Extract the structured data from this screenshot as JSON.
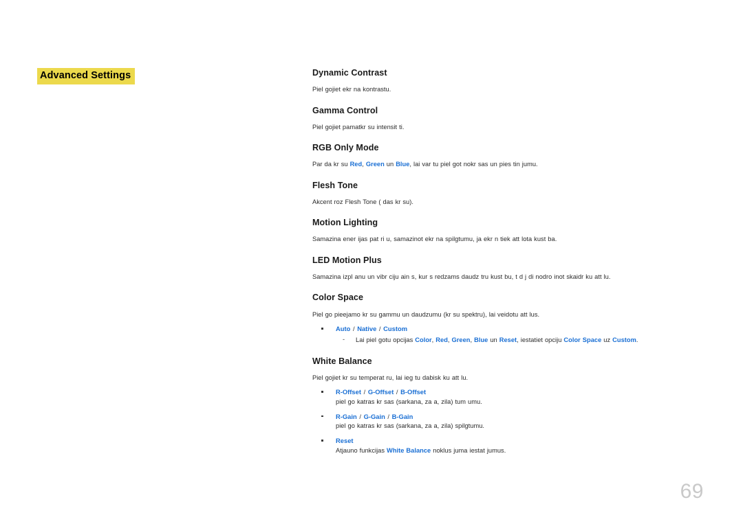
{
  "chapter": {
    "title": "Advanced Settings",
    "highlight_color": "#ecd94c"
  },
  "colors": {
    "accent_blue": "#1a6fd4",
    "heading": "#1a1a1a",
    "body": "#2b2b2b",
    "page_number": "#c9c9c9"
  },
  "settings": [
    {
      "heading": "Dynamic Contrast",
      "desc": "Piel gojiet ekr na kontrastu."
    },
    {
      "heading": "Gamma Control",
      "desc": "Piel gojiet pamatkr su intensit ti."
    },
    {
      "heading": "RGB Only Mode",
      "desc_parts": [
        {
          "t": "Par da kr su ",
          "style": "plain"
        },
        {
          "t": "Red",
          "style": "blue"
        },
        {
          "t": ", ",
          "style": "plain"
        },
        {
          "t": "Green",
          "style": "blue"
        },
        {
          "t": " un ",
          "style": "plain"
        },
        {
          "t": "Blue",
          "style": "blue"
        },
        {
          "t": ", lai var tu piel got nokr sas un pies tin jumu.",
          "style": "plain"
        }
      ]
    },
    {
      "heading": "Flesh Tone",
      "desc": "Akcent roz  Flesh Tone ( das kr su)."
    },
    {
      "heading": "Motion Lighting",
      "desc": "Samazina ener ijas pat ri u, samazinot ekr na spilgtumu, ja ekr n  tiek att lota kust ba."
    },
    {
      "heading": "LED Motion Plus",
      "desc": "Samazina izpl  anu un vibr ciju ain s, kur s redzams daudz  tru kust bu, t d j di nodro inot skaidr ku att lu."
    },
    {
      "heading": "Color Space",
      "desc": "Piel go pieejamo kr su gammu un daudzumu (kr su spektru), lai veidotu att lus.",
      "bullets": [
        {
          "title_parts": [
            {
              "t": "Auto",
              "style": "blue"
            },
            {
              "t": " / ",
              "style": "sep"
            },
            {
              "t": "Native",
              "style": "blue"
            },
            {
              "t": " / ",
              "style": "sep"
            },
            {
              "t": "Custom",
              "style": "blue"
            }
          ],
          "dashes": [
            {
              "parts": [
                {
                  "t": "Lai piel gotu opcijas ",
                  "style": "plain"
                },
                {
                  "t": "Color",
                  "style": "blue"
                },
                {
                  "t": ", ",
                  "style": "plain"
                },
                {
                  "t": "Red",
                  "style": "blue"
                },
                {
                  "t": ", ",
                  "style": "plain"
                },
                {
                  "t": "Green",
                  "style": "blue"
                },
                {
                  "t": ", ",
                  "style": "plain"
                },
                {
                  "t": "Blue",
                  "style": "blue"
                },
                {
                  "t": " un ",
                  "style": "plain"
                },
                {
                  "t": "Reset",
                  "style": "blue"
                },
                {
                  "t": ", iestatiet opciju ",
                  "style": "plain"
                },
                {
                  "t": "Color Space",
                  "style": "blue"
                },
                {
                  "t": " uz ",
                  "style": "plain"
                },
                {
                  "t": "Custom",
                  "style": "blue"
                },
                {
                  "t": ".",
                  "style": "plain"
                }
              ]
            }
          ]
        }
      ]
    },
    {
      "heading": "White Balance",
      "desc": "Piel gojiet kr su temperat ru, lai ieg tu dabisk ku att lu.",
      "bullets": [
        {
          "title_parts": [
            {
              "t": "R-Offset",
              "style": "blue"
            },
            {
              "t": " / ",
              "style": "sep"
            },
            {
              "t": "G-Offset",
              "style": "blue"
            },
            {
              "t": " / ",
              "style": "sep"
            },
            {
              "t": "B-Offset",
              "style": "blue"
            }
          ],
          "sub_parts": [
            {
              "t": "piel go katras kr sas (sarkana, za a, zila) tum umu.",
              "style": "plain"
            }
          ]
        },
        {
          "title_parts": [
            {
              "t": "R-Gain",
              "style": "blue"
            },
            {
              "t": " / ",
              "style": "sep"
            },
            {
              "t": "G-Gain",
              "style": "blue"
            },
            {
              "t": " / ",
              "style": "sep"
            },
            {
              "t": "B-Gain",
              "style": "blue"
            }
          ],
          "sub_parts": [
            {
              "t": "piel go katras kr sas (sarkana, za a, zila) spilgtumu.",
              "style": "plain"
            }
          ]
        },
        {
          "title_parts": [
            {
              "t": "Reset",
              "style": "blue"
            }
          ],
          "sub_parts": [
            {
              "t": "Atjauno funkcijas ",
              "style": "plain"
            },
            {
              "t": "White Balance",
              "style": "blue"
            },
            {
              "t": " noklus juma iestat jumus.",
              "style": "plain"
            }
          ]
        }
      ]
    }
  ],
  "page_number": "69"
}
